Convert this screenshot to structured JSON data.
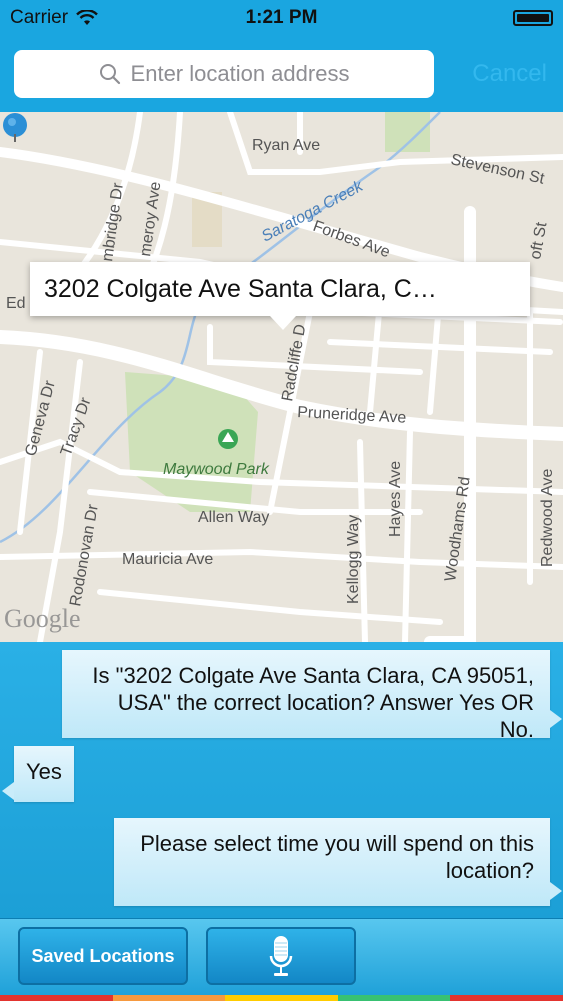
{
  "status": {
    "carrier": "Carrier",
    "time": "1:21 PM"
  },
  "search": {
    "placeholder": "Enter location address",
    "cancel_label": "Cancel"
  },
  "map": {
    "callout": "3202 Colgate Ave Santa Clara, C…",
    "logo": "Google",
    "labels": {
      "ryan": "Ryan Ave",
      "stevenson": "Stevenson St",
      "saratoga": "Saratoga Creek",
      "forbes": "Forbes Ave",
      "cambridge": "mbridge Dr",
      "pomeroy": "meroy Ave",
      "geneva": "Geneva Dr",
      "tracy": "Tracy Dr",
      "radcliffe": "Radcliffe D",
      "pruneridge": "Pruneridge Ave",
      "maywood": "Maywood Park",
      "allen": "Allen Way",
      "mauricia": "Mauricia Ave",
      "rodonovan": "Rodonovan Dr",
      "kellogg": "Kellogg Way",
      "hayes": "Hayes Ave",
      "woodhams": "Woodhams Rd",
      "redwood": "Redwood Ave",
      "oft": "oft St",
      "ed": "Ed"
    }
  },
  "chat": {
    "messages": [
      {
        "side": "right",
        "text": "Is \"3202 Colgate Ave Santa Clara, CA 95051, USA\" the correct location? Answer Yes OR No."
      },
      {
        "side": "left",
        "text": "Yes"
      },
      {
        "side": "right",
        "text": "Please select time you will spend on this location?"
      }
    ]
  },
  "bottom": {
    "saved_label": "Saved Locations",
    "mic_icon": "microphone-icon"
  },
  "colors": {
    "header_blue": "#1aa6e0",
    "bubble": "#d7f1fb",
    "strip": [
      "#e3342f",
      "#f6993f",
      "#ffcc00",
      "#38c172",
      "#2aa9dd"
    ]
  }
}
